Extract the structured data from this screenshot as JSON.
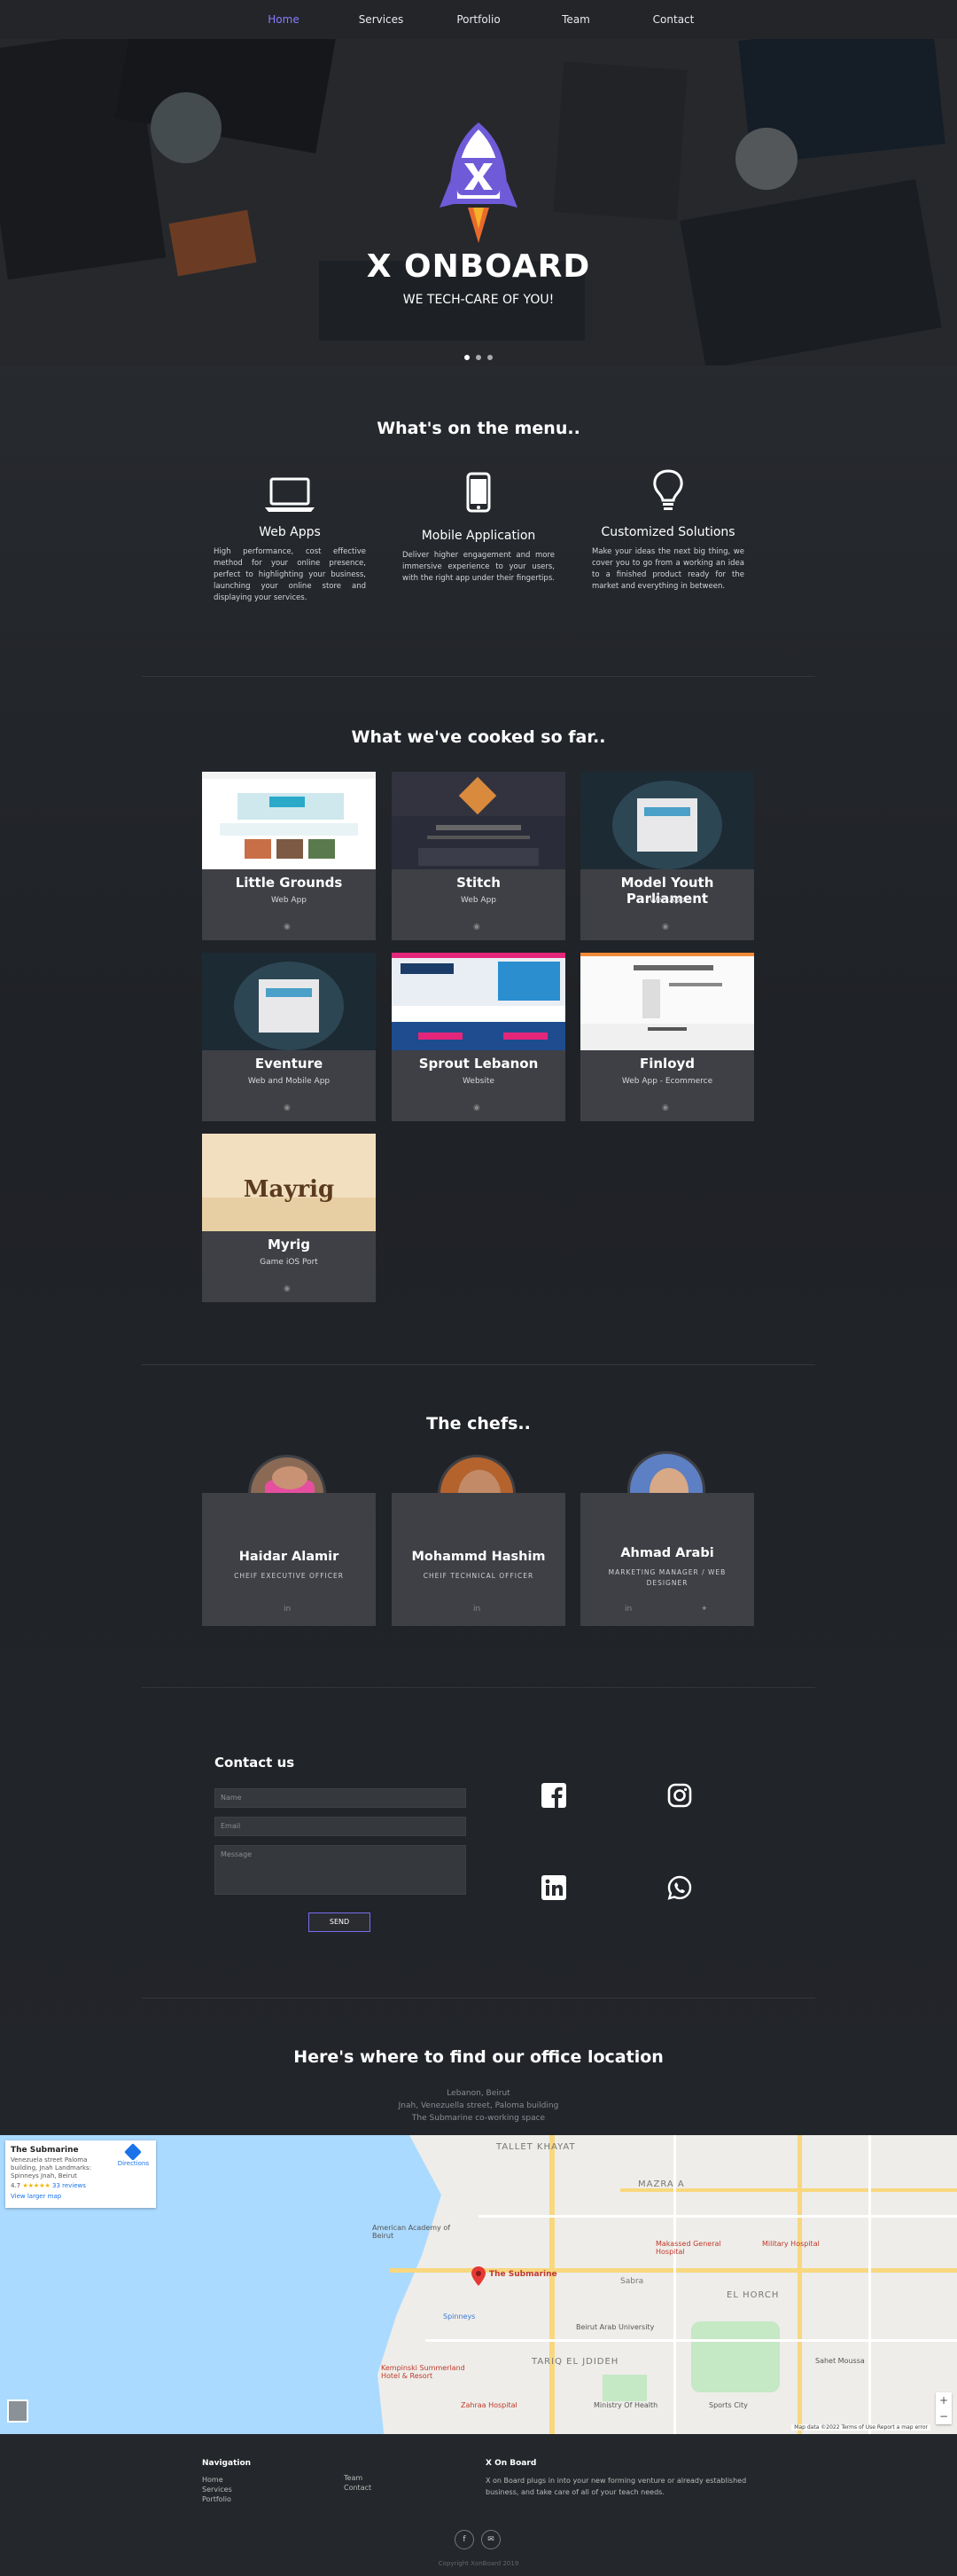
{
  "nav": {
    "items": [
      "Home",
      "Services",
      "Portfolio",
      "Team",
      "Contact"
    ],
    "active": "Home"
  },
  "hero": {
    "title": "X ONBOARD",
    "tagline": "WE TECH-CARE OF YOU!"
  },
  "services": {
    "title": "What's on the menu..",
    "items": [
      {
        "title": "Web Apps",
        "text": "High performance, cost effective method for your online presence, perfect to highlighting your business, launching your online store and displaying your services.",
        "icon": "laptop-icon"
      },
      {
        "title": "Mobile Application",
        "text": "Deliver higher engagement and more immersive experience to your users, with the right app under their fingertips.",
        "icon": "mobile-icon"
      },
      {
        "title": "Customized Solutions",
        "text": "Make your ideas the next big thing, we cover you to go from a working an idea to a finished product ready for the market and everything in between.",
        "icon": "lightbulb-icon"
      }
    ]
  },
  "portfolio": {
    "title": "What we've cooked so far..",
    "items": [
      {
        "name": "Little Grounds",
        "type": "Web App"
      },
      {
        "name": "Stitch",
        "type": "Web App"
      },
      {
        "name": "Model Youth Parliament",
        "type": "Web App"
      },
      {
        "name": "Eventure",
        "type": "Web and Mobile App"
      },
      {
        "name": "Sprout Lebanon",
        "type": "Website"
      },
      {
        "name": "Finloyd",
        "type": "Web App - Ecommerce"
      },
      {
        "name": "Myrig",
        "type": "Game iOS Port"
      }
    ],
    "shot_texts": {
      "myrig_logo": "Mayrig"
    }
  },
  "team": {
    "title": "The chefs..",
    "members": [
      {
        "name": "Haidar Alamir",
        "role": "CHEIF EXECUTIVE OFFICER"
      },
      {
        "name": "Mohammd Hashim",
        "role": "CHEIF TECHNICAL OFFICER"
      },
      {
        "name": "Ahmad Arabi",
        "role": "MARKETING MANAGER / WEB DESIGNER"
      }
    ]
  },
  "contact": {
    "title": "Contact us",
    "name_placeholder": "Name",
    "email_placeholder": "Email",
    "message_placeholder": "Message",
    "send_label": "SEND"
  },
  "location": {
    "title": "Here's where to find our office location",
    "line1": "Lebanon, Beirut",
    "line2": "Jnah, Venezuella street, Paloma building",
    "line3": "The Submarine co-working space",
    "map": {
      "place": "The Submarine",
      "address": "Venezuela street Paloma building, Jnah Landmarks: Spinneys Jnah, Beirut",
      "rating": "4.7",
      "reviews": "33 reviews",
      "directions": "Directions",
      "larger": "View larger map",
      "pin_label": "The Submarine",
      "labels": [
        "TALLET KHAYAT",
        "MAZRA A",
        "TARIQ EL JDIDEH",
        "EL HORCH",
        "Makassed General Hospital",
        "Military Hospital",
        "Beirut Arab University",
        "Kempinski Summerland Hotel & Resort",
        "Zahraa Hospital",
        "Ministry Of Health",
        "Sabra",
        "Sports City",
        "Sahet Moussa",
        "Spinneys",
        "American Academy of Beirut"
      ],
      "footer": "Map data ©2022  Terms of Use  Report a map error"
    }
  },
  "footer": {
    "nav_title": "Navigation",
    "col1": [
      "Home",
      "Services",
      "Portfolio"
    ],
    "col2": [
      "Team",
      "Contact"
    ],
    "about_title": "X On Board",
    "about_text": "X on Board plugs in into your new forming venture or already established business, and take care of all of your teach needs.",
    "copyright": "Copyright XonBoard 2019"
  },
  "colors": {
    "accent": "#8d7cff",
    "background": "#26292e",
    "card": "#3e4045"
  }
}
